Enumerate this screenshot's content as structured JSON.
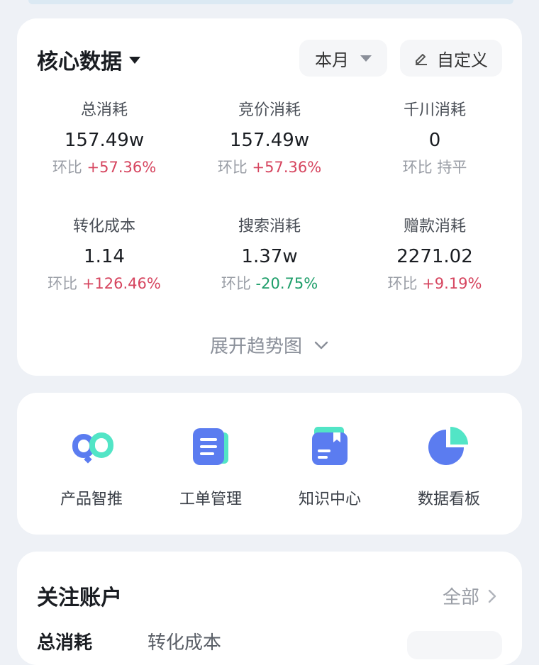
{
  "core": {
    "title": "核心数据",
    "period": "本月",
    "custom": "自定义",
    "expand": "展开趋势图",
    "metrics": [
      {
        "label": "总消耗",
        "value": "157.49w",
        "comp_prefix": "环比",
        "comp_value": "+57.36%",
        "trend": "up"
      },
      {
        "label": "竞价消耗",
        "value": "157.49w",
        "comp_prefix": "环比",
        "comp_value": "+57.36%",
        "trend": "up"
      },
      {
        "label": "千川消耗",
        "value": "0",
        "comp_prefix": "环比",
        "comp_value": "持平",
        "trend": "flat"
      },
      {
        "label": "转化成本",
        "value": "1.14",
        "comp_prefix": "环比",
        "comp_value": "+126.46%",
        "trend": "up"
      },
      {
        "label": "搜索消耗",
        "value": "1.37w",
        "comp_prefix": "环比",
        "comp_value": "-20.75%",
        "trend": "down"
      },
      {
        "label": "赠款消耗",
        "value": "2271.02",
        "comp_prefix": "环比",
        "comp_value": "+9.19%",
        "trend": "up"
      }
    ]
  },
  "tools": [
    {
      "label": "产品智推",
      "icon": "product-recommend-icon"
    },
    {
      "label": "工单管理",
      "icon": "work-order-icon"
    },
    {
      "label": "知识中心",
      "icon": "knowledge-center-icon"
    },
    {
      "label": "数据看板",
      "icon": "data-dashboard-icon"
    }
  ],
  "watch": {
    "title": "关注账户",
    "all": "全部",
    "tabs": [
      "总消耗",
      "转化成本"
    ]
  },
  "colors": {
    "up": "#d6455f",
    "down": "#1e9e6a",
    "icon_blue": "#5b7cf0",
    "icon_teal": "#52e5c6"
  }
}
